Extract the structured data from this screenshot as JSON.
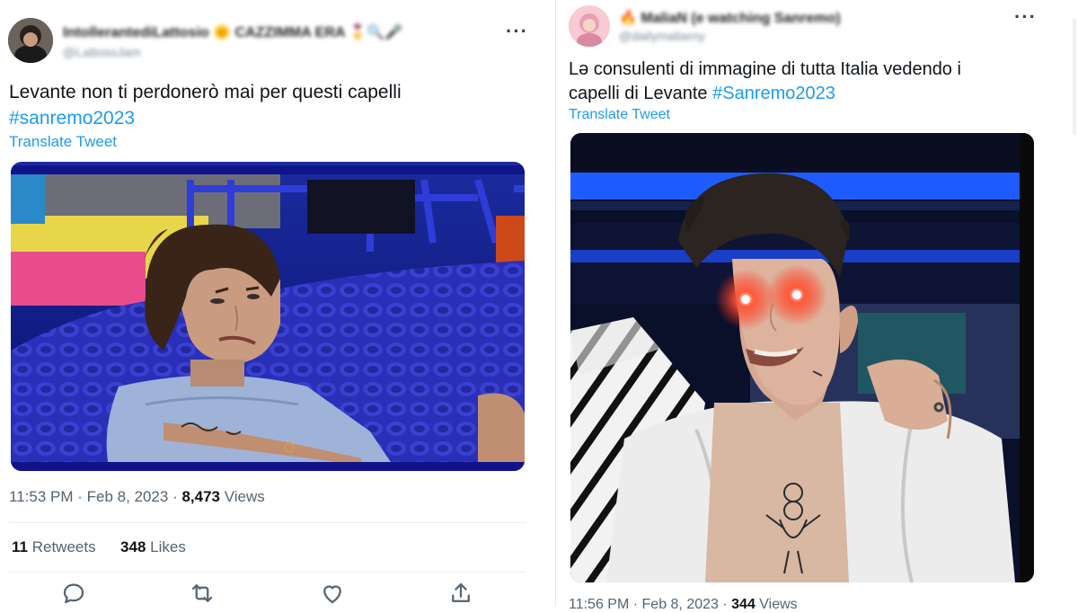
{
  "tweet_left": {
    "author_name": "IntollerantediLattosio 🌞 CAZZIMMA ERA 🎖️🔍🎤",
    "author_handle": "@LattosoJam",
    "more_label": "···",
    "text_plain": "Levante non ti perdonerò mai per questi capelli",
    "hashtag": "#sanremo2023",
    "translate_label": "Translate Tweet",
    "image_alt": "Man with curly hair lying on blue cushions making a face",
    "time": "11:53 PM · Feb 8, 2023 · ",
    "views_count": "8,473",
    "views_label": " Views",
    "retweets_count": "11",
    "retweets_label": " Retweets",
    "likes_count": "348",
    "likes_label": " Likes"
  },
  "tweet_right": {
    "author_name": "🔥 MaliaN (e watching Sanremo)",
    "author_handle": "@dailymaliarny",
    "more_label": "···",
    "text_line1": "Lə consulenti di immagine di tutta Italia vedendo i",
    "text_line2_plain": "capelli di Levante ",
    "hashtag": "#Sanremo2023",
    "translate_label": "Translate Tweet",
    "image_alt": "Young man with short dark hair and glowing red laser eyes",
    "time": "11:56 PM · Feb 8, 2023 · ",
    "views_count": "344",
    "views_label": " Views"
  },
  "icons": [
    "reply-icon",
    "retweet-icon",
    "like-icon",
    "share-icon"
  ],
  "colors": {
    "link": "#1d9bf0",
    "text": "#0f1419",
    "muted": "#536471"
  }
}
